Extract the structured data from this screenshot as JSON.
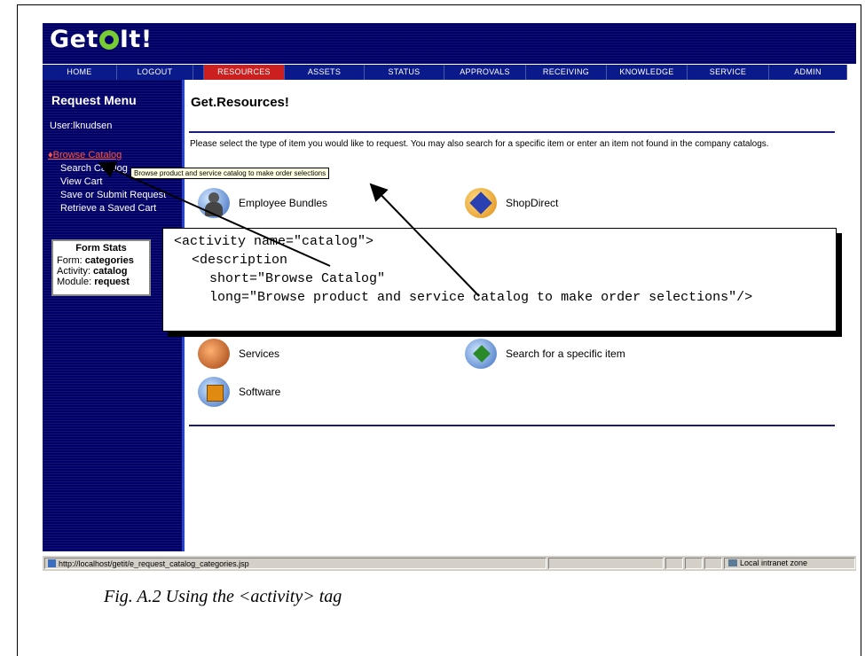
{
  "app": {
    "logo_text": "Get",
    "logo_text2": "It!"
  },
  "nav": [
    {
      "label": "HOME",
      "active": false
    },
    {
      "label": "LOGOUT",
      "active": false
    },
    {
      "label": "RESOURCES",
      "active": true
    },
    {
      "label": "ASSETS",
      "active": false
    },
    {
      "label": "STATUS",
      "active": false
    },
    {
      "label": "APPROVALS",
      "active": false
    },
    {
      "label": "RECEIVING",
      "active": false
    },
    {
      "label": "KNOWLEDGE",
      "active": false
    },
    {
      "label": "SERVICE",
      "active": false
    },
    {
      "label": "ADMIN",
      "active": false
    }
  ],
  "sidebar": {
    "title": "Request Menu",
    "user": "User:lknudsen",
    "items": [
      {
        "label": "Browse Catalog"
      },
      {
        "label": "Search Catalog"
      },
      {
        "label": "View Cart"
      },
      {
        "label": "Save or Submit Request"
      },
      {
        "label": "Retrieve a Saved Cart"
      }
    ],
    "stats": {
      "title": "Form Stats",
      "form_label": "Form: ",
      "form_value": "categories",
      "activity_label": "Activity: ",
      "activity_value": "catalog",
      "module_label": "Module: ",
      "module_value": "request"
    }
  },
  "main": {
    "title": "Get.Resources!",
    "intro": "Please select the type of item you would like to request. You may also search for a specific item or enter an item not found in the company catalogs.",
    "items": [
      {
        "label": "Employee Bundles",
        "icon": "employee-bundles-icon"
      },
      {
        "label": "ShopDirect",
        "icon": "shopdirect-icon"
      },
      {
        "label": "Services",
        "icon": "services-icon"
      },
      {
        "label": "Search for a specific item",
        "icon": "search-item-icon"
      },
      {
        "label": "Software",
        "icon": "software-icon"
      }
    ],
    "tooltip": "Browse product and service catalog to make order selections"
  },
  "statusbar": {
    "url": "http://localhost/getit/e_request_catalog_categories.jsp",
    "zone": "Local intranet zone"
  },
  "code": {
    "line1": "<activity name=\"catalog\">",
    "line2": "<description",
    "line3": "short=\"Browse Catalog\"",
    "line4": "long=\"Browse product and service catalog to make order selections\"/>"
  },
  "caption": "Fig. A.2  Using the <activity> tag",
  "colors": {
    "header_bg": "#000066",
    "nav_bg": "#0b1a8a",
    "nav_active": "#cc1f1f",
    "active_link": "#ff5544"
  }
}
